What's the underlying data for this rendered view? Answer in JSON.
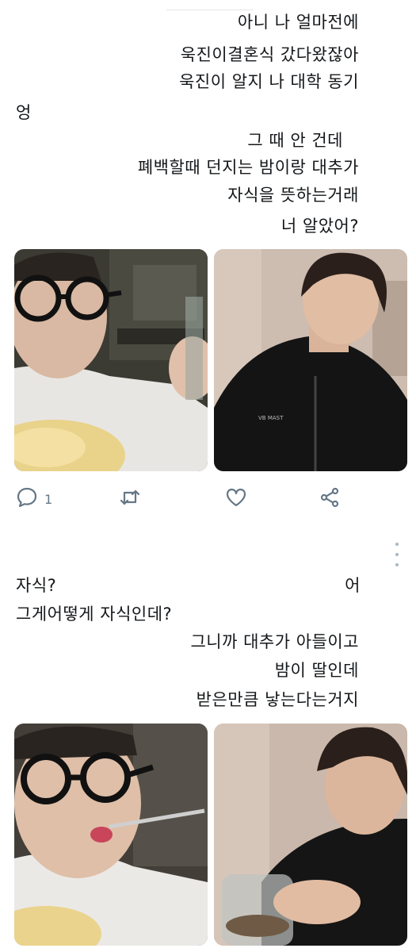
{
  "tweet1": {
    "lines": [
      "아니 나 얼마전에",
      "욱진이결혼식 갔다왔잖아",
      "욱진이 알지 나 대학 동기",
      "엉",
      "그 때 안 건데",
      "폐백할때 던지는 밤이랑 대추가",
      "자식을 뜻하는거래",
      "너 알았어?"
    ],
    "reply_count": "1"
  },
  "tweet2": {
    "lines": [
      "자식?",
      "어",
      "그게어떻게 자식인데?",
      "그니까 대추가 아들이고",
      "밤이 딸인데",
      "받은만큼 낳는다는거지"
    ]
  },
  "icons": {
    "reply": "reply-icon",
    "retweet": "retweet-icon",
    "like": "heart-icon",
    "share": "share-icon",
    "more": "more-vertical-icon"
  },
  "colors": {
    "text": "#14171a",
    "action_gray": "#657786"
  }
}
